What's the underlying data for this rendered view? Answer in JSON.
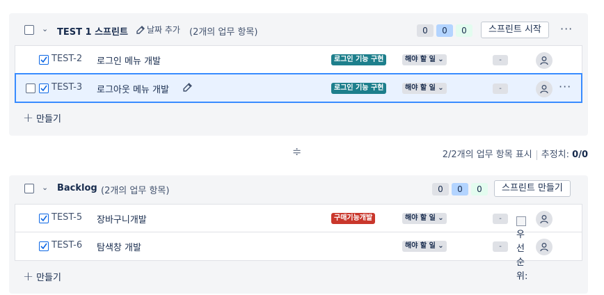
{
  "sprint": {
    "title": "TEST 1 스프린트",
    "add_date_label": "날짜 추가",
    "count_label": "(2개의 업무 항목)",
    "status_counts": [
      "0",
      "0",
      "0"
    ],
    "start_button": "스프린트 시작",
    "more_label": "···",
    "issues": [
      {
        "key": "TEST-2",
        "summary": "로그인 메뉴 개발",
        "epic": "로그인 기능 구현",
        "status": "해야 할 일",
        "estimate": "-",
        "selected": false
      },
      {
        "key": "TEST-3",
        "summary": "로그아웃 메뉴 개발",
        "epic": "로그인 기능 구현",
        "status": "해야 할 일",
        "estimate": "-",
        "selected": true
      }
    ],
    "create_label": "만들기"
  },
  "summary": {
    "shown": "2/2개의 업무 항목 표시",
    "estimate_label": "추정치:",
    "estimate_value": "0/0"
  },
  "backlog": {
    "title": "Backlog",
    "count_label": "(2개의 업무 항목)",
    "status_counts": [
      "0",
      "0",
      "0"
    ],
    "create_sprint_button": "스프린트 만들기",
    "issues": [
      {
        "key": "TEST-5",
        "summary": "장바구니개발",
        "epic": "구매기능개발",
        "status": "해야 할 일",
        "estimate": "-"
      },
      {
        "key": "TEST-6",
        "summary": "탐색창 개발",
        "epic": "",
        "status": "해야 할 일",
        "estimate": "-"
      }
    ],
    "priority_alt": "우선순위:",
    "create_label": "만들기"
  },
  "icons": {
    "status_dropdown": "chevron-down-icon",
    "edit": "edit-icon",
    "avatar": "person-icon",
    "resize": "drag-handle-icon"
  },
  "colors": {
    "epic_teal": "#1d7f8c",
    "epic_red": "#c9372c",
    "selection_border": "#388bff",
    "selection_bg": "#e9f2ff"
  }
}
